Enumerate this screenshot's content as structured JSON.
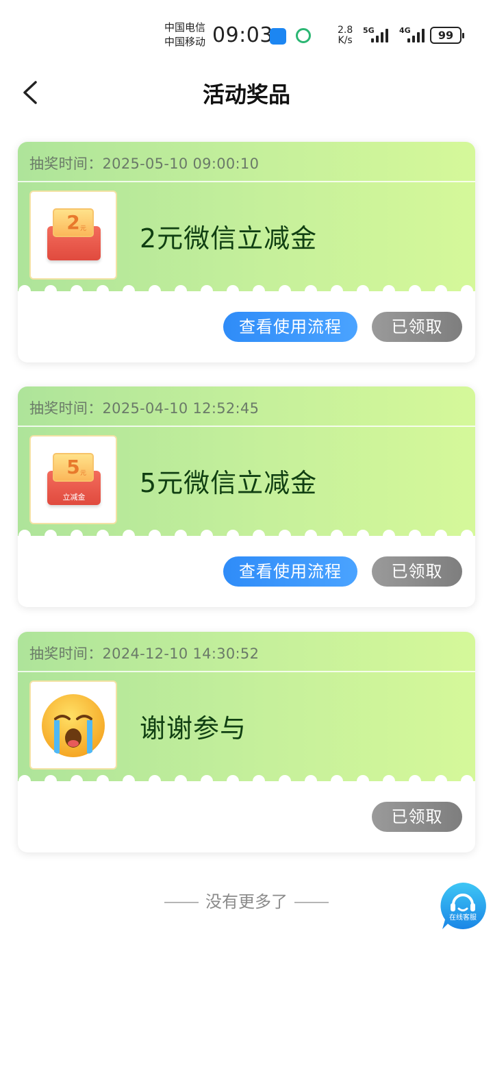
{
  "status_bar": {
    "carrier_1": "中国电信",
    "carrier_2": "中国移动",
    "time": "09:03",
    "net_speed_value": "2.8",
    "net_speed_unit": "K/s",
    "signal_1_label": "5G",
    "signal_2_label": "4G",
    "battery": "99"
  },
  "header": {
    "title": "活动奖品",
    "back_icon": "chevron-left-icon"
  },
  "prizes": [
    {
      "time_label": "抽奖时间：",
      "time": "2025-05-10 09:00:10",
      "name": "2元微信立减金",
      "image": {
        "type": "voucher",
        "amount": "2",
        "unit": "元",
        "label": ""
      },
      "guide_button": "查看使用流程",
      "status_button": "已领取"
    },
    {
      "time_label": "抽奖时间：",
      "time": "2025-04-10 12:52:45",
      "name": "5元微信立减金",
      "image": {
        "type": "voucher",
        "amount": "5",
        "unit": "元",
        "label": "立减金"
      },
      "guide_button": "查看使用流程",
      "status_button": "已领取"
    },
    {
      "time_label": "抽奖时间：",
      "time": "2024-12-10 14:30:52",
      "name": "谢谢参与",
      "image": {
        "type": "crying-emoji"
      },
      "status_button": "已领取"
    }
  ],
  "footer": {
    "no_more": "没有更多了"
  },
  "customer_service": {
    "label": "在线客服",
    "icon": "headset-icon"
  },
  "colors": {
    "card_gradient_start": "#aee49a",
    "card_gradient_end": "#d5f89a",
    "primary_button": "#3a96fb",
    "disabled_button": "#8a8a8a",
    "prize_text": "#103f12"
  }
}
